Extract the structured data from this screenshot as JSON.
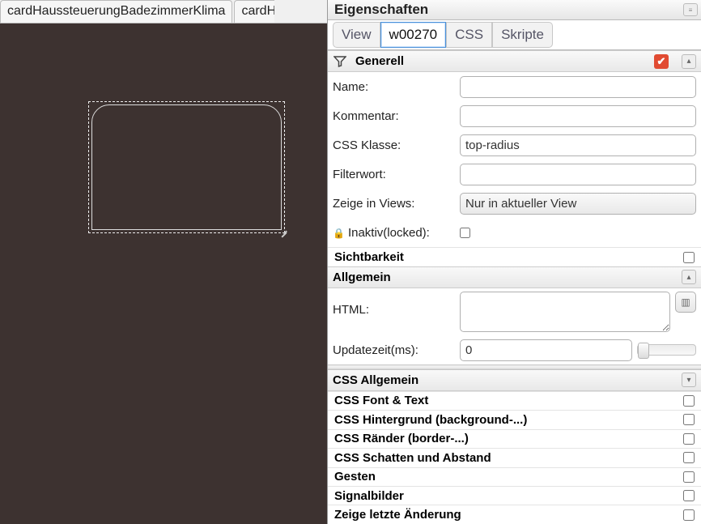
{
  "left": {
    "tabs": [
      "cardHaussteuerungBadezimmerKlima",
      "cardH"
    ]
  },
  "panel": {
    "title": "Eigenschaften",
    "minimize": "≡"
  },
  "mode_tabs": {
    "view": "View",
    "widget": "w00270",
    "css": "CSS",
    "scripts": "Skripte"
  },
  "generell": {
    "title": "Generell",
    "name_label": "Name:",
    "name_value": "",
    "comment_label": "Kommentar:",
    "comment_value": "",
    "cssclass_label": "CSS Klasse:",
    "cssclass_value": "top-radius",
    "filter_label": "Filterwort:",
    "filter_value": "",
    "views_label": "Zeige in Views:",
    "views_value": "Nur in aktueller View",
    "locked_label": "Inaktiv(locked):"
  },
  "sichtbarkeit": {
    "title": "Sichtbarkeit"
  },
  "allgemein": {
    "title": "Allgemein",
    "html_label": "HTML:",
    "html_value": "",
    "update_label": "Updatezeit(ms):",
    "update_value": "0"
  },
  "css_allgemein": {
    "title": "CSS Allgemein"
  },
  "sections": {
    "font": "CSS Font & Text",
    "bg": "CSS Hintergrund (background-...)",
    "border": "CSS Ränder (border-...)",
    "shadow": "CSS Schatten und Abstand",
    "gesten": "Gesten",
    "signal": "Signalbilder",
    "lastchange": "Zeige letzte Änderung"
  }
}
